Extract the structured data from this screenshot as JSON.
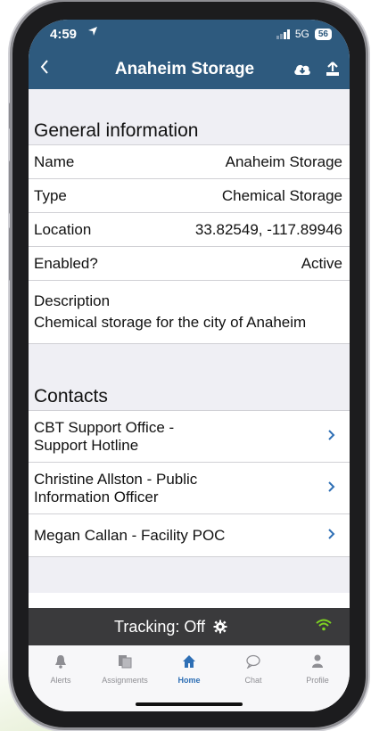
{
  "status": {
    "time": "4:59",
    "network": "5G",
    "battery": "56"
  },
  "nav": {
    "title": "Anaheim Storage"
  },
  "general": {
    "header": "General information",
    "rows": [
      {
        "label": "Name",
        "value": "Anaheim Storage"
      },
      {
        "label": "Type",
        "value": "Chemical Storage"
      },
      {
        "label": "Location",
        "value": "33.82549, -117.89946"
      },
      {
        "label": "Enabled?",
        "value": "Active"
      }
    ],
    "description_label": "Description",
    "description_value": "Chemical storage for the city of Anaheim"
  },
  "contacts": {
    "header": "Contacts",
    "items": [
      {
        "line1": "CBT Support Office -",
        "line2": "Support Hotline"
      },
      {
        "line1": "Christine Allston - Public",
        "line2": "Information Officer"
      },
      {
        "line1": "Megan Callan - Facility POC",
        "line2": ""
      }
    ]
  },
  "tracking": {
    "text": "Tracking: Off"
  },
  "tabs": [
    {
      "label": "Alerts",
      "icon": "bell-icon"
    },
    {
      "label": "Assignments",
      "icon": "assignments-icon"
    },
    {
      "label": "Home",
      "icon": "home-icon"
    },
    {
      "label": "Chat",
      "icon": "chat-bubble-icon"
    },
    {
      "label": "Profile",
      "icon": "person-icon"
    }
  ],
  "colors": {
    "nav": "#2e5a7e",
    "accent": "#2e6fb5",
    "tracking_bar": "#3a3a3c",
    "wifi": "#7ed321"
  }
}
